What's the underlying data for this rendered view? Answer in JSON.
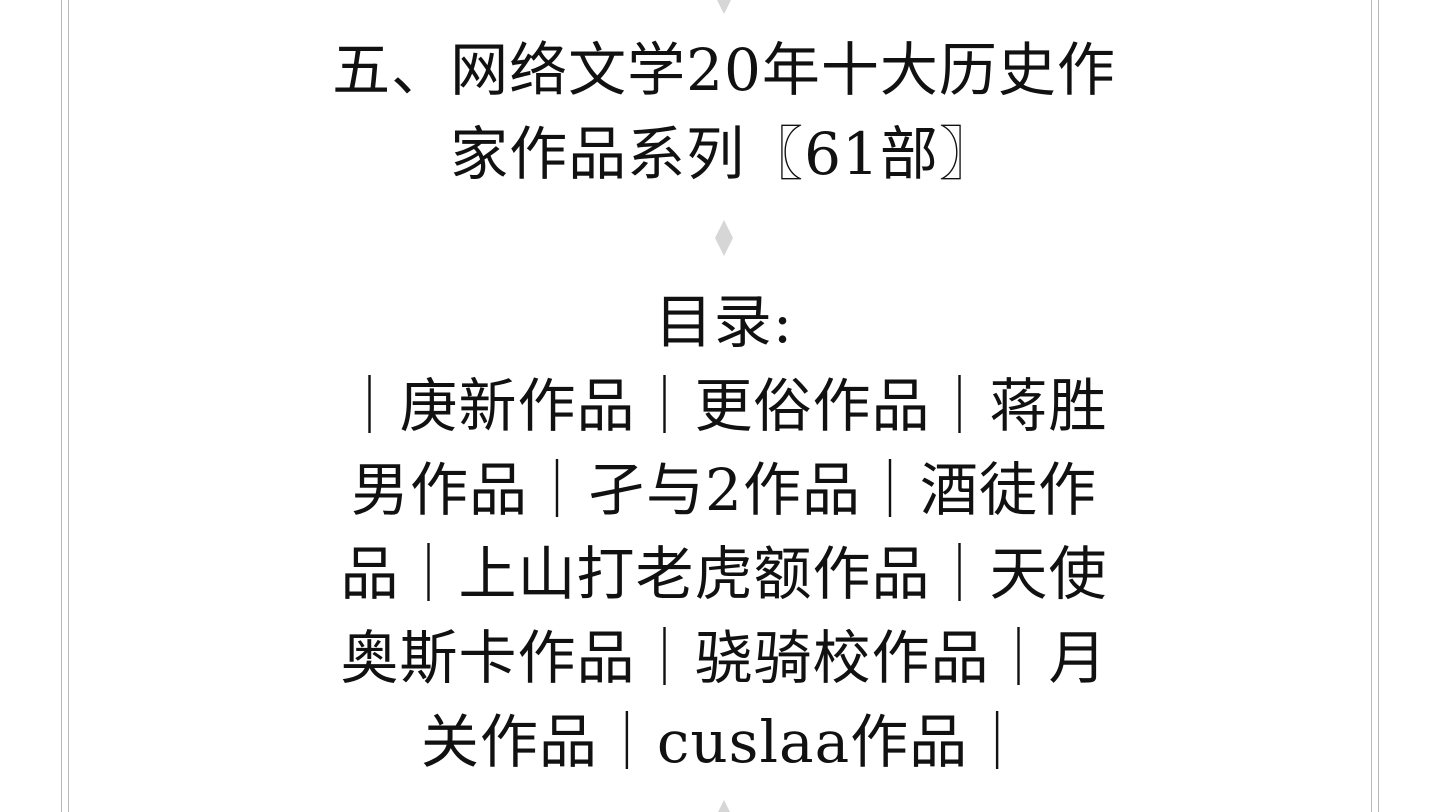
{
  "title": {
    "line1": "五、网络文学20年十大历史作",
    "line2": "家作品系列〖61部〗"
  },
  "toc": {
    "heading": "目录:",
    "lines": [
      "｜庚新作品｜更俗作品｜蒋胜",
      "男作品｜孑与2作品｜酒徒作",
      "品｜上山打老虎额作品｜天使",
      "奥斯卡作品｜骁骑校作品｜月",
      "关作品｜cuslaa作品｜"
    ]
  },
  "ornament_icon": "diamond-ornament-icon",
  "colors": {
    "text": "#111111",
    "ornament": "#d6d6d6",
    "border_rule": "#b8b8b8",
    "background": "#ffffff"
  }
}
